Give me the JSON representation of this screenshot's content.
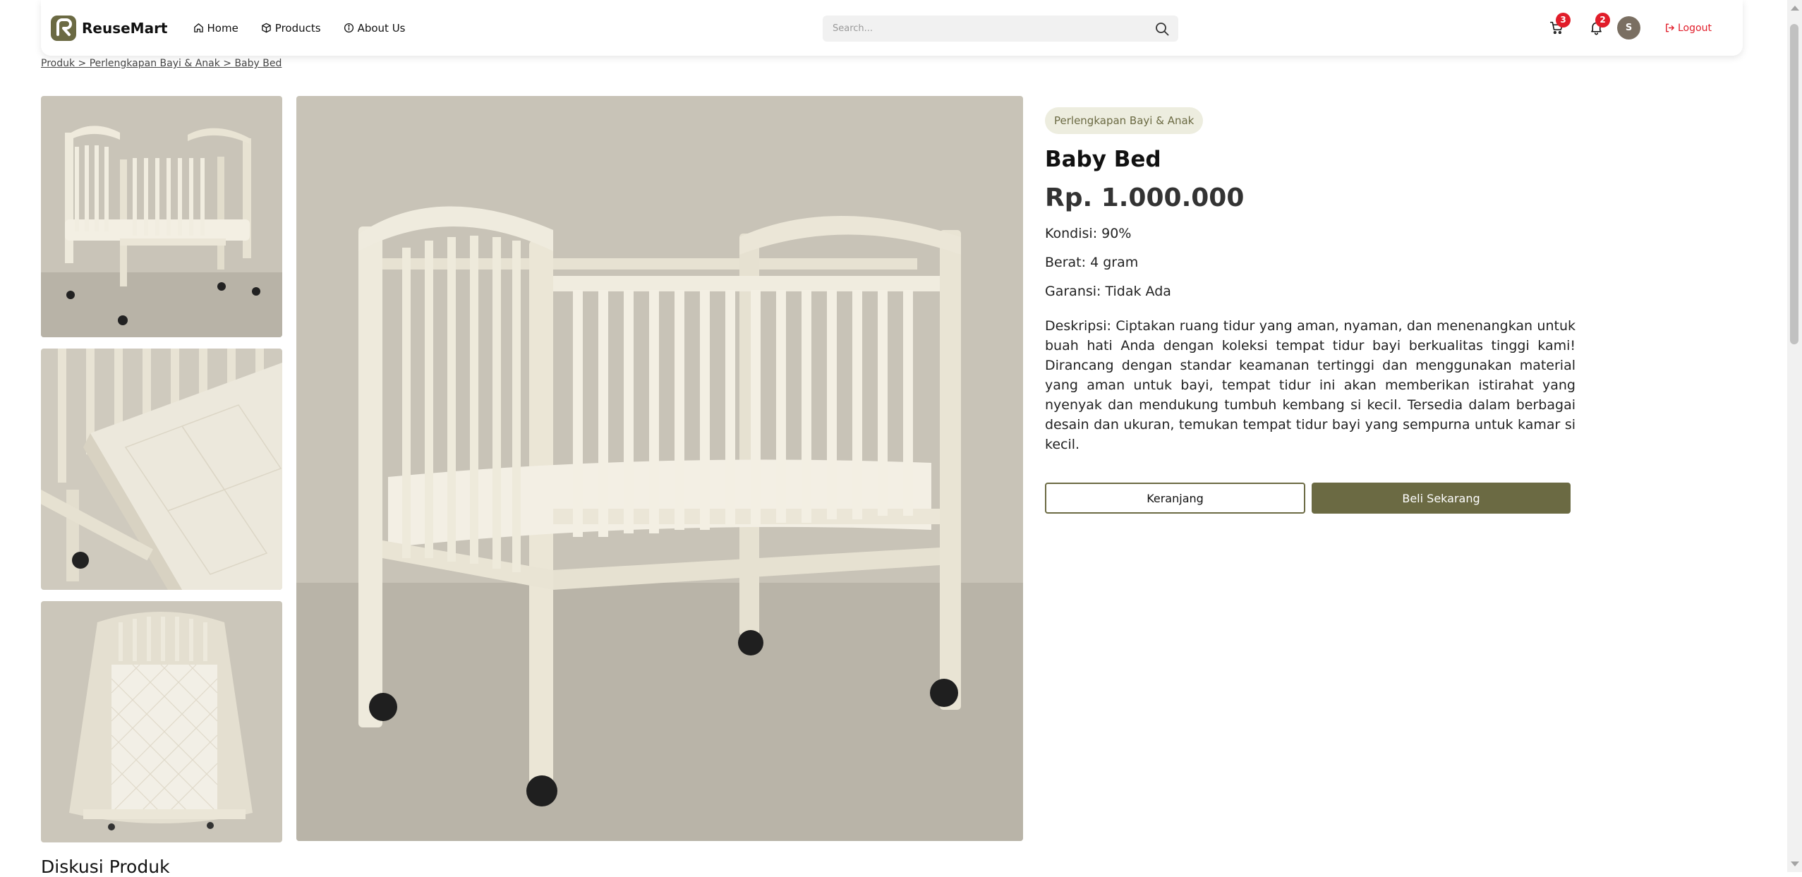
{
  "navbar": {
    "brand": "ReuseMart",
    "links": [
      {
        "label": "Home",
        "icon": "home-icon"
      },
      {
        "label": "Products",
        "icon": "box-icon"
      },
      {
        "label": "About Us",
        "icon": "info-icon"
      }
    ],
    "search_placeholder": "Search...",
    "cart_count": "3",
    "notification_count": "2",
    "avatar_initial": "S",
    "logout_label": "Logout"
  },
  "breadcrumb": "Produk > Perlengkapan Bayi & Anak > Baby Bed",
  "product": {
    "category": "Perlengkapan Bayi & Anak",
    "name": "Baby Bed",
    "price": "Rp. 1.000.000",
    "condition": "Kondisi: 90%",
    "weight": "Berat: 4 gram",
    "warranty": "Garansi: Tidak Ada",
    "description": "Deskripsi: Ciptakan ruang tidur yang aman, nyaman, dan menenangkan untuk buah hati Anda dengan koleksi tempat tidur bayi berkualitas tinggi kami! Dirancang dengan standar keamanan tertinggi dan menggunakan material yang aman untuk bayi, tempat tidur ini akan memberikan istirahat yang nyenyak dan mendukung tumbuh kembang si kecil. Tersedia dalam berbagai desain dan ukuran, temukan tempat tidur bayi yang sempurna untuk kamar si kecil.",
    "cart_button": "Keranjang",
    "buy_button": "Beli Sekarang"
  },
  "discussion_title": "Diskusi Produk",
  "colors": {
    "accent": "#6b6a43",
    "badge": "#e11d2a",
    "chip_bg": "#ededdf"
  }
}
